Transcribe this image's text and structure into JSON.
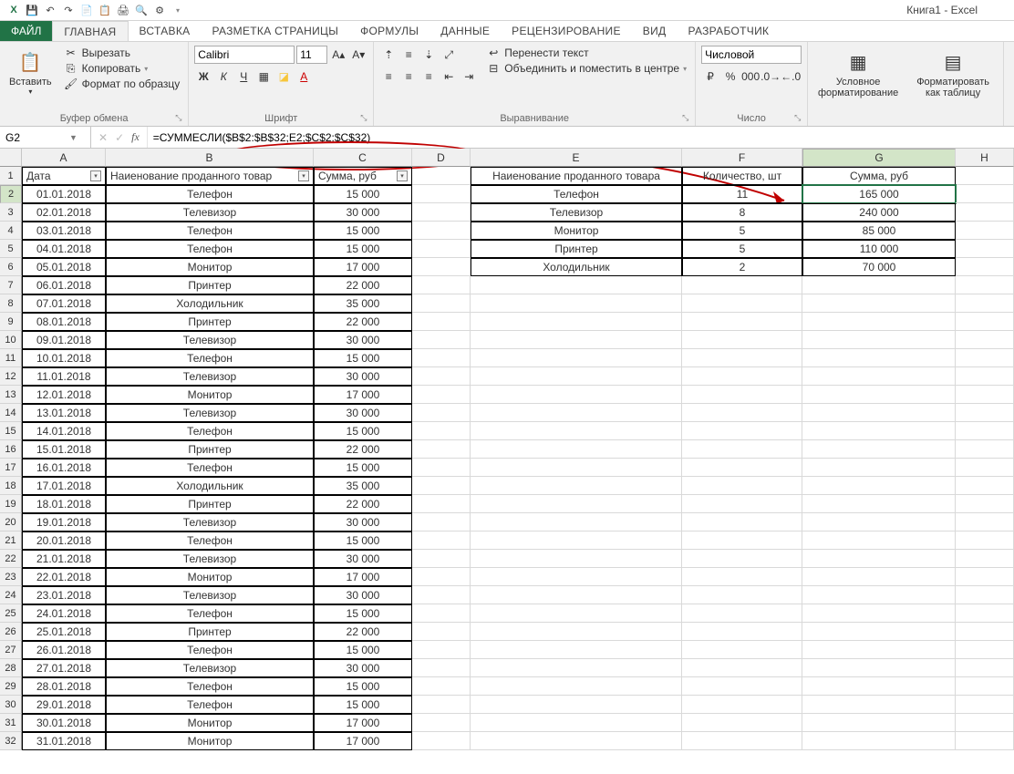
{
  "app": {
    "title": "Книга1 - Excel"
  },
  "qat": {
    "save": "💾",
    "undo": "↶",
    "redo": "↷"
  },
  "tabs": {
    "file": "ФАЙЛ",
    "items": [
      "ГЛАВНАЯ",
      "ВСТАВКА",
      "РАЗМЕТКА СТРАНИЦЫ",
      "ФОРМУЛЫ",
      "ДАННЫЕ",
      "РЕЦЕНЗИРОВАНИЕ",
      "ВИД",
      "РАЗРАБОТЧИК"
    ]
  },
  "ribbon": {
    "clipboard": {
      "paste": "Вставить",
      "cut": "Вырезать",
      "copy": "Копировать",
      "painter": "Формат по образцу",
      "label": "Буфер обмена"
    },
    "font": {
      "name": "Calibri",
      "size": "11",
      "label": "Шрифт"
    },
    "align": {
      "wrap": "Перенести текст",
      "merge": "Объединить и поместить в центре",
      "label": "Выравнивание"
    },
    "number": {
      "format": "Числовой",
      "label": "Число"
    },
    "styles": {
      "cond": "Условное форматирование",
      "table": "Форматировать как таблицу",
      "label": ""
    }
  },
  "fbar": {
    "name": "G2",
    "formula": "=СУММЕСЛИ($B$2:$B$32;E2;$C$2:$C$32)"
  },
  "columns": [
    "A",
    "B",
    "C",
    "D",
    "E",
    "F",
    "G",
    "H"
  ],
  "headers1": {
    "A": "Дата",
    "B": "Наиенование проданного товар",
    "C": "Сумма, руб"
  },
  "headers2": {
    "E": "Наиенование проданного товара",
    "F": "Количество, шт",
    "G": "Сумма, руб"
  },
  "table1": [
    [
      "01.01.2018",
      "Телефон",
      "15 000"
    ],
    [
      "02.01.2018",
      "Телевизор",
      "30 000"
    ],
    [
      "03.01.2018",
      "Телефон",
      "15 000"
    ],
    [
      "04.01.2018",
      "Телефон",
      "15 000"
    ],
    [
      "05.01.2018",
      "Монитор",
      "17 000"
    ],
    [
      "06.01.2018",
      "Принтер",
      "22 000"
    ],
    [
      "07.01.2018",
      "Холодильник",
      "35 000"
    ],
    [
      "08.01.2018",
      "Принтер",
      "22 000"
    ],
    [
      "09.01.2018",
      "Телевизор",
      "30 000"
    ],
    [
      "10.01.2018",
      "Телефон",
      "15 000"
    ],
    [
      "11.01.2018",
      "Телевизор",
      "30 000"
    ],
    [
      "12.01.2018",
      "Монитор",
      "17 000"
    ],
    [
      "13.01.2018",
      "Телевизор",
      "30 000"
    ],
    [
      "14.01.2018",
      "Телефон",
      "15 000"
    ],
    [
      "15.01.2018",
      "Принтер",
      "22 000"
    ],
    [
      "16.01.2018",
      "Телефон",
      "15 000"
    ],
    [
      "17.01.2018",
      "Холодильник",
      "35 000"
    ],
    [
      "18.01.2018",
      "Принтер",
      "22 000"
    ],
    [
      "19.01.2018",
      "Телевизор",
      "30 000"
    ],
    [
      "20.01.2018",
      "Телефон",
      "15 000"
    ],
    [
      "21.01.2018",
      "Телевизор",
      "30 000"
    ],
    [
      "22.01.2018",
      "Монитор",
      "17 000"
    ],
    [
      "23.01.2018",
      "Телевизор",
      "30 000"
    ],
    [
      "24.01.2018",
      "Телефон",
      "15 000"
    ],
    [
      "25.01.2018",
      "Принтер",
      "22 000"
    ],
    [
      "26.01.2018",
      "Телефон",
      "15 000"
    ],
    [
      "27.01.2018",
      "Телевизор",
      "30 000"
    ],
    [
      "28.01.2018",
      "Телефон",
      "15 000"
    ],
    [
      "29.01.2018",
      "Телефон",
      "15 000"
    ],
    [
      "30.01.2018",
      "Монитор",
      "17 000"
    ],
    [
      "31.01.2018",
      "Монитор",
      "17 000"
    ]
  ],
  "table2": [
    [
      "Телефон",
      "11",
      "165 000"
    ],
    [
      "Телевизор",
      "8",
      "240 000"
    ],
    [
      "Монитор",
      "5",
      "85 000"
    ],
    [
      "Принтер",
      "5",
      "110 000"
    ],
    [
      "Холодильник",
      "2",
      "70 000"
    ]
  ]
}
